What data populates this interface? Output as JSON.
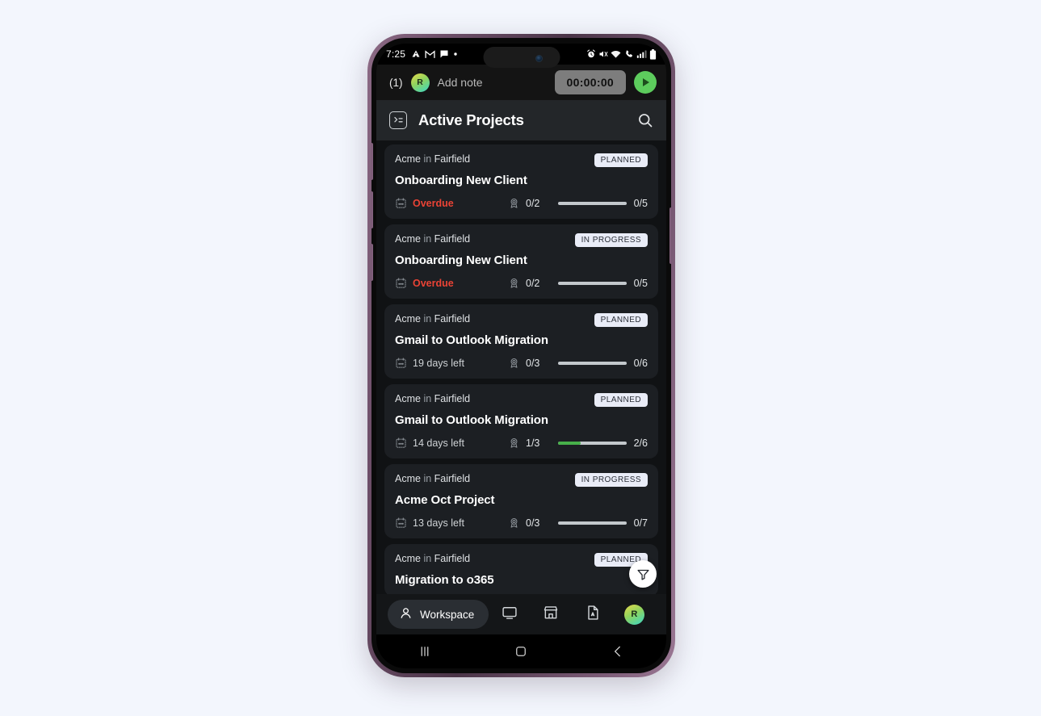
{
  "status_bar": {
    "time": "7:25",
    "left_icons": [
      "drive-icon",
      "gmail-icon",
      "message-icon",
      "dot-icon"
    ],
    "right_icons": [
      "alarm-icon",
      "mute-icon",
      "wifi-icon",
      "vibrate-call-icon",
      "signal-icon",
      "battery-icon"
    ]
  },
  "note_bar": {
    "count": "(1)",
    "avatar_initial": "R",
    "placeholder": "Add note",
    "timer": "00:00:00",
    "play_label": "play-icon"
  },
  "header": {
    "logo": "terminal-icon",
    "title": "Active Projects",
    "search": "search-icon"
  },
  "projects": [
    {
      "org": "Acme",
      "connector": "in",
      "location": "Fairfield",
      "status": "PLANNED",
      "title": "Onboarding New Client",
      "date_text": "Overdue",
      "overdue": true,
      "people": "0/2",
      "progress_text": "0/5",
      "progress_pct": 0
    },
    {
      "org": "Acme",
      "connector": "in",
      "location": "Fairfield",
      "status": "IN PROGRESS",
      "title": "Onboarding New Client",
      "date_text": "Overdue",
      "overdue": true,
      "people": "0/2",
      "progress_text": "0/5",
      "progress_pct": 0
    },
    {
      "org": "Acme",
      "connector": "in",
      "location": "Fairfield",
      "status": "PLANNED",
      "title": "Gmail to Outlook Migration",
      "date_text": "19 days left",
      "overdue": false,
      "people": "0/3",
      "progress_text": "0/6",
      "progress_pct": 0
    },
    {
      "org": "Acme",
      "connector": "in",
      "location": "Fairfield",
      "status": "PLANNED",
      "title": "Gmail to Outlook Migration",
      "date_text": "14 days left",
      "overdue": false,
      "people": "1/3",
      "progress_text": "2/6",
      "progress_pct": 33
    },
    {
      "org": "Acme",
      "connector": "in",
      "location": "Fairfield",
      "status": "IN PROGRESS",
      "title": "Acme Oct Project",
      "date_text": "13 days left",
      "overdue": false,
      "people": "0/3",
      "progress_text": "0/7",
      "progress_pct": 0
    },
    {
      "org": "Acme",
      "connector": "in",
      "location": "Fairfield",
      "status": "PLANNED",
      "title": "Migration to o365",
      "date_text": "",
      "overdue": false,
      "people": "",
      "progress_text": "",
      "progress_pct": 0
    }
  ],
  "filter_fab": "filter-icon",
  "bottom_nav": {
    "workspace_label": "Workspace",
    "items": [
      "person-icon",
      "monitor-icon",
      "store-icon",
      "document-icon",
      "avatar"
    ],
    "avatar_initial": "R"
  },
  "android_nav": {
    "recents": "recents-icon",
    "home": "home-icon",
    "back": "back-icon"
  },
  "colors": {
    "accent_green": "#47b04a",
    "overdue_red": "#ea4335",
    "badge_bg": "#e9ecf7",
    "card_bg": "#1c1f23",
    "screen_bg": "#101214"
  }
}
